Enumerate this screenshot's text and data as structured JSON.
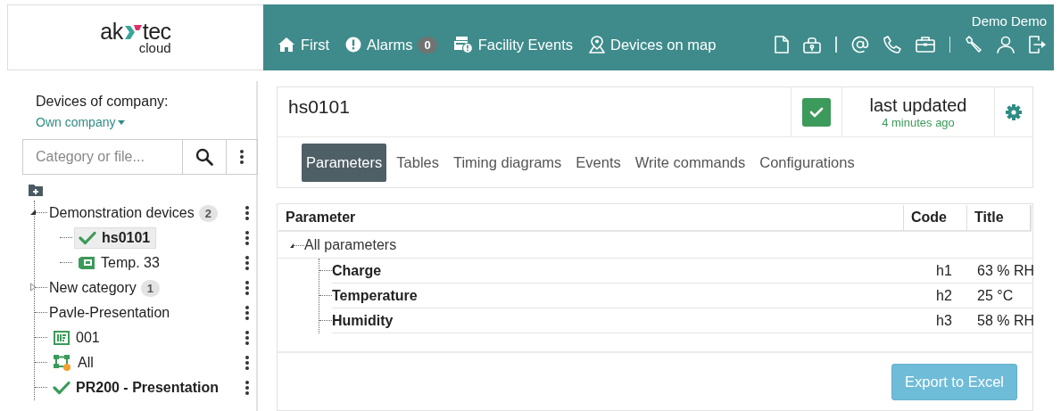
{
  "logo": {
    "left": "ak",
    "right": "tec",
    "sub": "cloud"
  },
  "header": {
    "user": "Demo Demo",
    "nav": [
      {
        "label": "First"
      },
      {
        "label": "Alarms",
        "count": "0"
      },
      {
        "label": "Facility Events"
      },
      {
        "label": "Devices on map"
      }
    ]
  },
  "sidebar": {
    "title": "Devices of company:",
    "company": "Own company",
    "search": {
      "placeholder": "Category or file..."
    },
    "tree": [
      {
        "label": "Demonstration devices",
        "kind": "category",
        "count": "2",
        "expanded": true,
        "children": [
          {
            "label": "hs0101",
            "kind": "device",
            "online": true,
            "selected": true
          },
          {
            "label": "Temp. 33",
            "kind": "module",
            "online": false,
            "selected": false
          }
        ]
      },
      {
        "label": "New category",
        "kind": "category",
        "count": "1",
        "expanded": false
      },
      {
        "label": "Pavle-Presentation",
        "kind": "category"
      },
      {
        "label": "001",
        "kind": "panel",
        "online": false,
        "selected": false
      },
      {
        "label": "All",
        "kind": "flow",
        "online": false,
        "selected": false
      },
      {
        "label": "PR200 - Presentation",
        "kind": "device",
        "online": true,
        "selected": false
      }
    ]
  },
  "device": {
    "name": "hs0101",
    "status_ok": true,
    "updated_label": "last updated",
    "updated_ago": "4 minutes ago",
    "tabs": [
      {
        "label": "Parameters",
        "selected": true
      },
      {
        "label": "Tables",
        "selected": false
      },
      {
        "label": "Timing diagrams",
        "selected": false
      },
      {
        "label": "Events",
        "selected": false
      },
      {
        "label": "Write commands",
        "selected": false
      },
      {
        "label": "Configurations",
        "selected": false
      }
    ]
  },
  "table": {
    "columns": [
      "Parameter",
      "Code",
      "Title"
    ],
    "group": {
      "label": "All parameters",
      "expanded": true
    },
    "rows": [
      {
        "parameter": "Charge",
        "code": "h1",
        "title": "63 % RH"
      },
      {
        "parameter": "Temperature",
        "code": "h2",
        "title": "25 °C"
      },
      {
        "parameter": "Humidity",
        "code": "h3",
        "title": "58 % RH"
      }
    ],
    "export_button": "Export to Excel"
  }
}
